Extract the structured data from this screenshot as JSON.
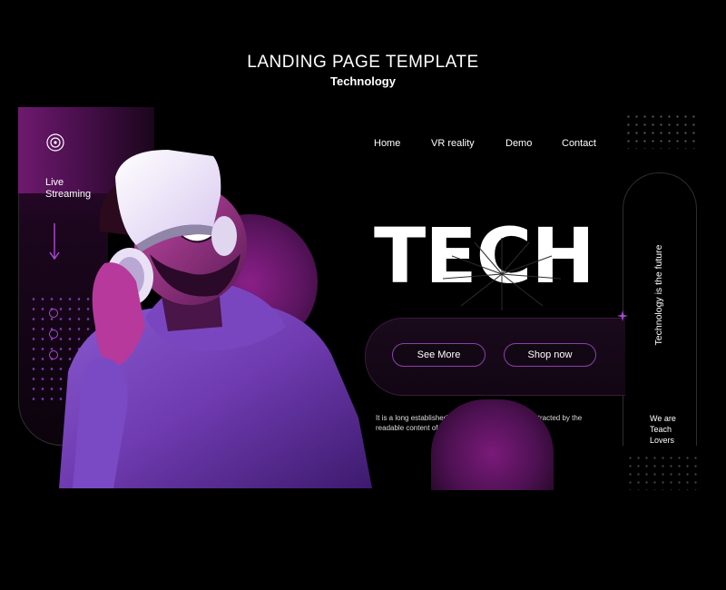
{
  "header": {
    "title": "LANDING PAGE TEMPLATE",
    "subtitle": "Technology"
  },
  "left_panel": {
    "icon": "ring-icon",
    "live_label_line1": "Live",
    "live_label_line2": "Streaming",
    "arrow": "arrow-down-icon",
    "socials": [
      "instagram-icon",
      "facebook-icon",
      "twitter-icon"
    ]
  },
  "nav": {
    "items": [
      "Home",
      "VR reality",
      "Demo",
      "Contact"
    ]
  },
  "hero": {
    "headline": "TECH",
    "buttons": {
      "see_more": "See More",
      "shop_now": "Shop now"
    },
    "description": "It is a long established fact that a reader will be distracted by the readable content of a page when looking at its layout"
  },
  "right_panel": {
    "tagline": "Technology is the future",
    "lovers_line1": "We are",
    "lovers_line2": "Teach",
    "lovers_line3": "Lovers"
  },
  "colors": {
    "background": "#000000",
    "accent_purple": "#8a3fb0",
    "magenta": "#7a1a7a",
    "text": "#ffffff"
  }
}
